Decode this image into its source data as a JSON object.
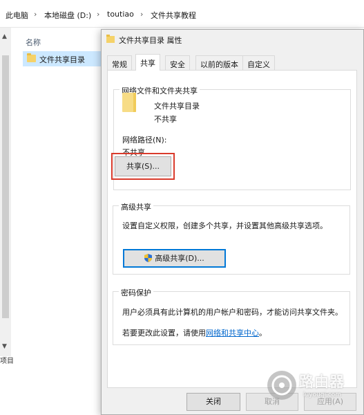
{
  "explorer": {
    "breadcrumb": [
      "此电脑",
      "本地磁盘 (D:)",
      "toutiao",
      "文件共享教程"
    ],
    "column_header": "名称",
    "selected_item": "文件共享目录",
    "status_text": "项目"
  },
  "dialog": {
    "title": "文件共享目录 属性",
    "tabs": [
      "常规",
      "共享",
      "安全",
      "以前的版本",
      "自定义"
    ],
    "active_tab": "共享",
    "network_sharing": {
      "group_title": "网络文件和文件夹共享",
      "folder_name": "文件共享目录",
      "folder_status": "不共享",
      "network_path_label": "网络路径(N):",
      "network_path_value": "不共享",
      "share_button": "共享(S)..."
    },
    "advanced_sharing": {
      "group_title": "高级共享",
      "description": "设置自定义权限，创建多个共享，并设置其他高级共享选项。",
      "button": "高级共享(D)..."
    },
    "password_protection": {
      "group_title": "密码保护",
      "description": "用户必须具有此计算机的用户帐户和密码，才能访问共享文件夹。",
      "change_prefix": "若要更改此设置，请使用",
      "link": "网络和共享中心",
      "change_suffix": "。"
    },
    "footer": {
      "close": "关闭",
      "cancel": "取消",
      "apply": "应用(A)"
    }
  },
  "watermark": {
    "brand": "路由器",
    "url": "luyouqi.com"
  },
  "colors": {
    "highlight_border": "#d93a2b",
    "link": "#0066cc",
    "selection": "#cce8ff",
    "dialog_bg": "#f0f0f0"
  }
}
